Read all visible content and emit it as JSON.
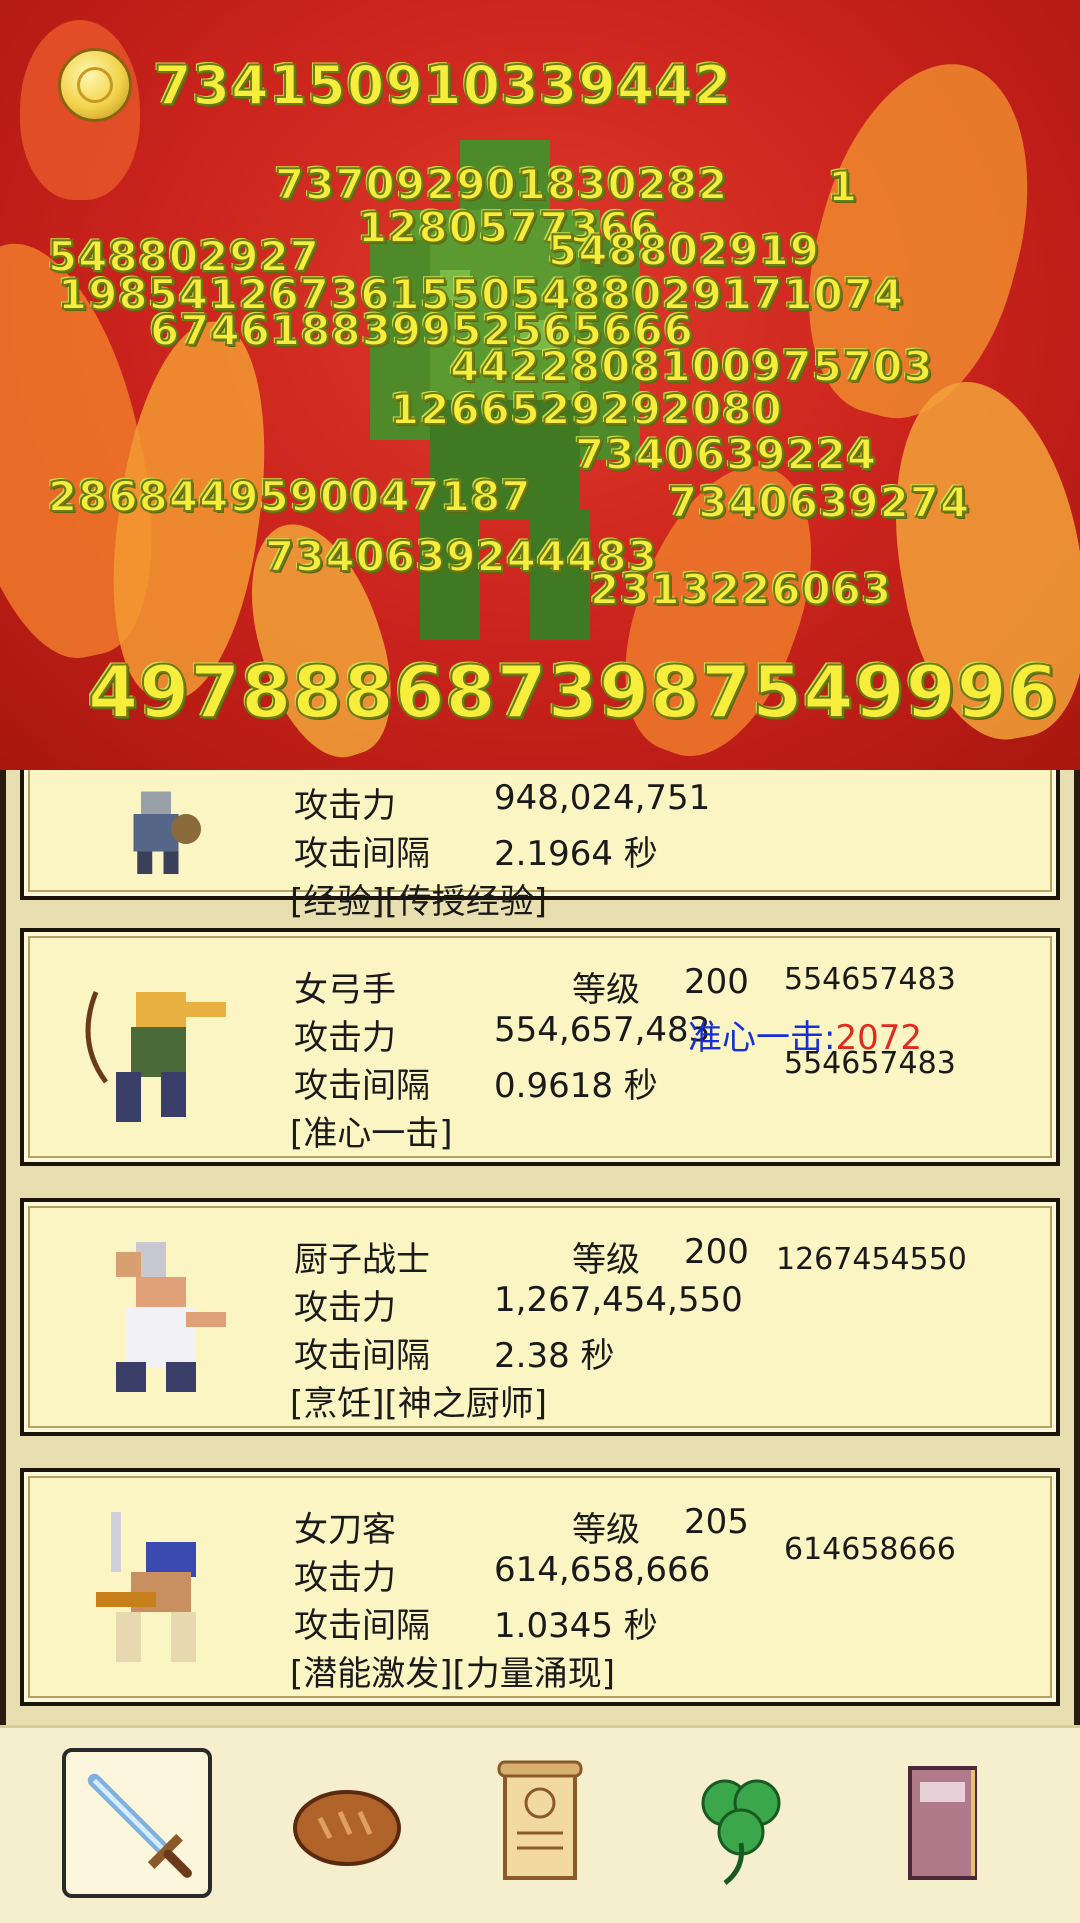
{
  "battle": {
    "gold": "734150910339442",
    "total_damage": "4978886873987549996",
    "floating_numbers": [
      {
        "text": "737092901830282"
      },
      {
        "text": "1"
      },
      {
        "text": "1280577366"
      },
      {
        "text": "548802927"
      },
      {
        "text": "548802919"
      },
      {
        "text": "1985412673615505488029171074"
      },
      {
        "text": "674618839952565666"
      },
      {
        "text": "4422808100975703"
      },
      {
        "text": "1266529292080"
      },
      {
        "text": "7340639224"
      },
      {
        "text": "2868449590047187"
      },
      {
        "text": "7340639274"
      },
      {
        "text": "7340639244483"
      },
      {
        "text": "2313226063"
      }
    ]
  },
  "heroes": [
    {
      "name": "",
      "level_label": "",
      "level": "",
      "attack_label": "攻击力",
      "attack": "948,024,751",
      "interval_label": "攻击间隔",
      "interval": "2.1964 秒",
      "skills": "[经验][传授经验]",
      "side_values": []
    },
    {
      "name": "女弓手",
      "level_label": "等级",
      "level": "200",
      "attack_label": "攻击力",
      "attack": "554,657,483",
      "interval_label": "攻击间隔",
      "interval": "0.9618 秒",
      "skills": "[准心一击]",
      "side_values": [
        "554657483",
        "554657483"
      ],
      "crit_label": "准心一击:",
      "crit_value": "2072"
    },
    {
      "name": "厨子战士",
      "level_label": "等级",
      "level": "200",
      "attack_label": "攻击力",
      "attack": "1,267,454,550",
      "interval_label": "攻击间隔",
      "interval": "2.38 秒",
      "skills": "[烹饪][神之厨师]",
      "side_values": [
        "1267454550"
      ]
    },
    {
      "name": "女刀客",
      "level_label": "等级",
      "level": "205",
      "attack_label": "攻击力",
      "attack": "614,658,666",
      "interval_label": "攻击间隔",
      "interval": "1.0345 秒",
      "skills": "[潜能激发][力量涌现]",
      "side_values": [
        "614658666"
      ]
    }
  ],
  "tabs": [
    {
      "icon": "sword-icon",
      "active": true
    },
    {
      "icon": "bread-icon",
      "active": false
    },
    {
      "icon": "scroll-icon",
      "active": false
    },
    {
      "icon": "clover-icon",
      "active": false
    },
    {
      "icon": "book-icon",
      "active": false
    }
  ],
  "colors": {
    "battle_bg": "#c9221c",
    "number_yellow": "#f6ee3a",
    "card_bg": "#fbf4c3",
    "crit_label": "#1630d8",
    "crit_value": "#e02a1e"
  }
}
